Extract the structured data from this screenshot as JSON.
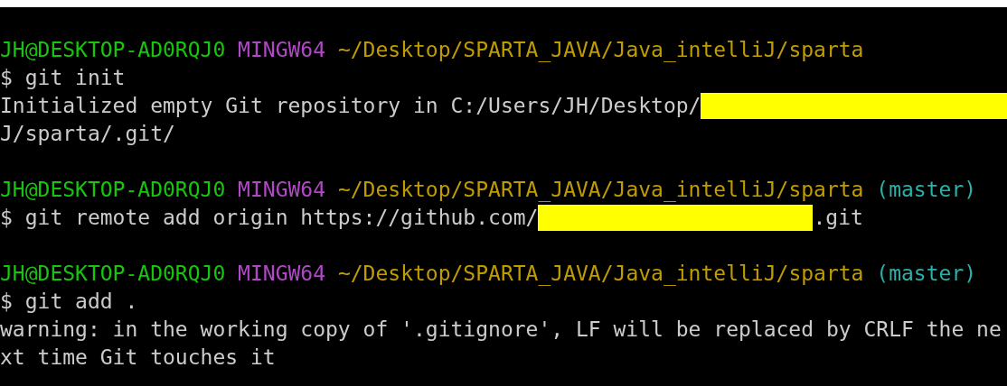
{
  "terminal": {
    "blocks": [
      {
        "lines": [
          {
            "segments": [
              {
                "text": "JH@DESKTOP-AD0RQJ0 ",
                "color": "#16c60c"
              },
              {
                "text": "MINGW64 ",
                "color": "#b148c6"
              },
              {
                "text": "~/Desktop/SPARTA_JAVA/Java_intelliJ/sparta",
                "color": "#c19c00"
              }
            ]
          },
          {
            "segments": [
              {
                "text": "$ git init",
                "color": "#cccccc"
              }
            ]
          },
          {
            "segments": [
              {
                "text": "Initialized empty Git repository in C:/Users/JH/Desktop/",
                "color": "#cccccc"
              },
              {
                "kind": "redaction"
              }
            ]
          },
          {
            "segments": [
              {
                "text": "J/sparta/.git/",
                "color": "#cccccc"
              }
            ]
          }
        ]
      },
      {
        "lines": [
          {
            "segments": [
              {
                "text": "JH@DESKTOP-AD0RQJ0 ",
                "color": "#16c60c"
              },
              {
                "text": "MINGW64 ",
                "color": "#b148c6"
              },
              {
                "text": "~/Desktop/SPARTA_JAVA/Java_intelliJ/sparta ",
                "color": "#c19c00"
              },
              {
                "text": "(master)",
                "color": "#2ab0a8"
              }
            ]
          },
          {
            "segments": [
              {
                "text": "$ git remote add origin https://github.com/",
                "color": "#cccccc"
              },
              {
                "kind": "redaction"
              },
              {
                "text": ".git",
                "color": "#cccccc"
              }
            ]
          }
        ]
      },
      {
        "lines": [
          {
            "segments": [
              {
                "text": "JH@DESKTOP-AD0RQJ0 ",
                "color": "#16c60c"
              },
              {
                "text": "MINGW64 ",
                "color": "#b148c6"
              },
              {
                "text": "~/Desktop/SPARTA_JAVA/Java_intelliJ/sparta ",
                "color": "#c19c00"
              },
              {
                "text": "(master)",
                "color": "#2ab0a8"
              }
            ]
          },
          {
            "segments": [
              {
                "text": "$ git add .",
                "color": "#cccccc"
              }
            ]
          },
          {
            "segments": [
              {
                "text": "warning: in the working copy of '.gitignore', LF will be replaced by CRLF the ne",
                "color": "#cccccc"
              }
            ]
          },
          {
            "segments": [
              {
                "text": "xt time Git touches it",
                "color": "#cccccc"
              }
            ]
          }
        ]
      }
    ]
  }
}
